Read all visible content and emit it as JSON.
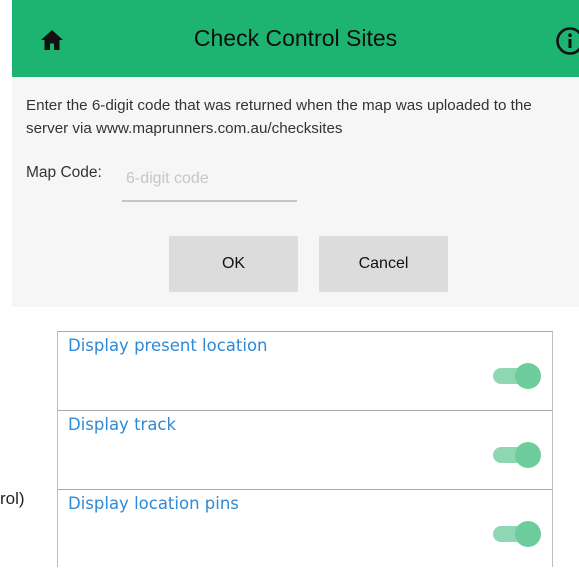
{
  "colors": {
    "header_bg": "#1db371",
    "toggle_on": "#6dcc9c",
    "link_blue": "#2d8ad8"
  },
  "dialog": {
    "title": "Check Control Sites",
    "home_icon": "home-icon",
    "info_icon": "info-icon",
    "instructions": "Enter the 6-digit code that was returned when the map was uploaded to the server via www.maprunners.com.au/checksites",
    "map_code_label": "Map Code:",
    "map_code_value": "",
    "map_code_placeholder": "6-digit code",
    "ok_label": "OK",
    "cancel_label": "Cancel"
  },
  "cutoff_text": "rol)",
  "settings": [
    {
      "label": "Display present location",
      "enabled": true
    },
    {
      "label": "Display track",
      "enabled": true
    },
    {
      "label": "Display location pins",
      "enabled": true
    }
  ]
}
